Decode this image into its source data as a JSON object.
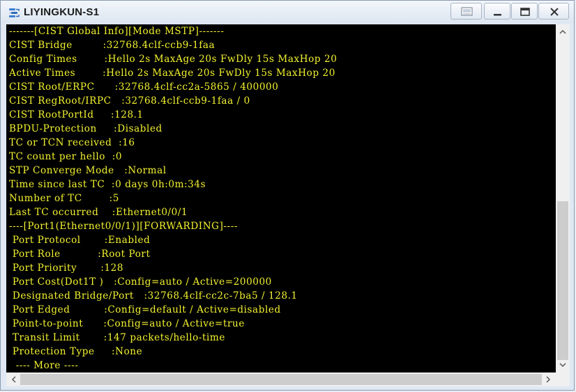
{
  "window": {
    "title": "LIYINGKUN-S1",
    "icons": {
      "app": "network-switch-icon",
      "screenshot": "screenshot-icon",
      "minimize": "minimize-icon",
      "maximize": "maximize-icon",
      "close": "close-icon"
    }
  },
  "terminal": {
    "lines": [
      "-------[CIST Global Info][Mode MSTP]-------",
      "CIST Bridge         :32768.4clf-ccb9-1faa",
      "Config Times        :Hello 2s MaxAge 20s FwDly 15s MaxHop 20",
      "Active Times        :Hello 2s MaxAge 20s FwDly 15s MaxHop 20",
      "CIST Root/ERPC      :32768.4clf-cc2a-5865 / 400000",
      "CIST RegRoot/IRPC   :32768.4clf-ccb9-1faa / 0",
      "CIST RootPortId     :128.1",
      "BPDU-Protection     :Disabled",
      "TC or TCN received  :16",
      "TC count per hello  :0",
      "STP Converge Mode   :Normal",
      "Time since last TC  :0 days 0h:0m:34s",
      "Number of TC        :5",
      "Last TC occurred    :Ethernet0/0/1",
      "----[Port1(Ethernet0/0/1)][FORWARDING]----",
      " Port Protocol       :Enabled",
      " Port Role           :Root Port",
      " Port Priority       :128",
      " Port Cost(Dot1T )   :Config=auto / Active=200000",
      " Designated Bridge/Port   :32768.4clf-cc2c-7ba5 / 128.1",
      " Port Edged          :Config=default / Active=disabled",
      " Point-to-point      :Config=auto / Active=true",
      " Transit Limit       :147 packets/hello-time",
      " Protection Type     :None",
      "  ---- More ----"
    ]
  },
  "scrollbars": {
    "vertical": {
      "up_icon": "chevron-up-icon",
      "down_icon": "chevron-down-icon",
      "position": 0.86
    },
    "horizontal": {
      "left_icon": "chevron-left-icon",
      "right_icon": "chevron-right-icon",
      "position": 0
    }
  },
  "colors": {
    "terminal_bg": "#000000",
    "terminal_fg": "#f2f230"
  }
}
